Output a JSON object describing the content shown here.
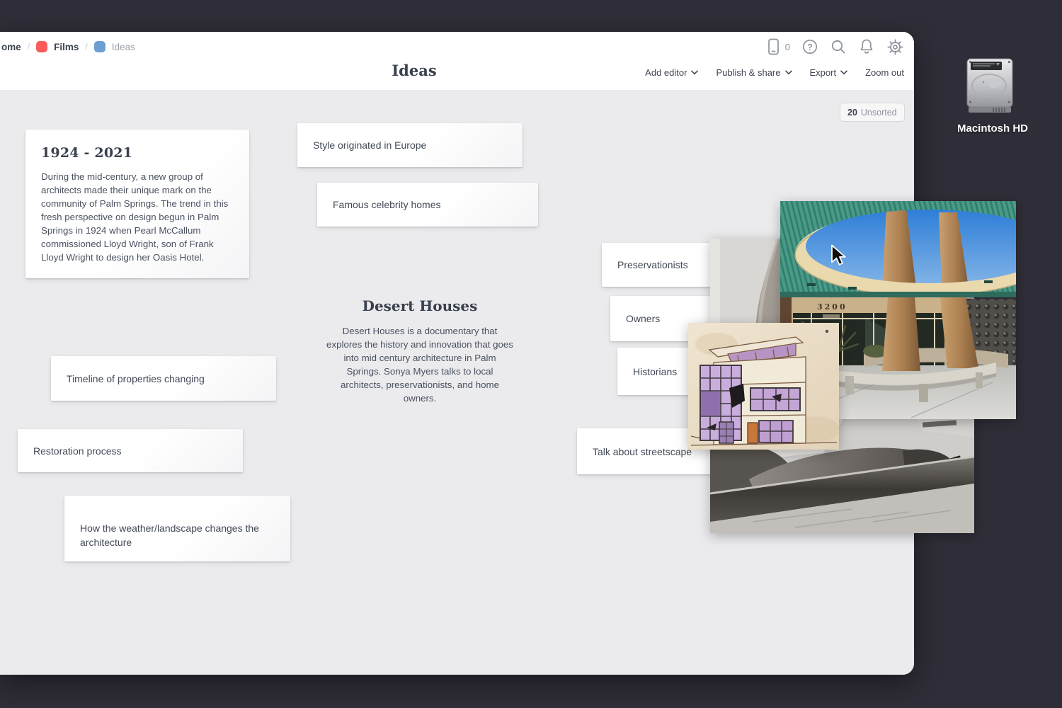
{
  "desktop": {
    "bg_color": "#2f2d37",
    "macintosh_hd_label": "Macintosh HD"
  },
  "window": {
    "breadcrumb": {
      "home_label": "ome",
      "separator": "/",
      "films_label": "Films",
      "ideas_label": "Ideas",
      "films_chip_color": "#fc5b5b",
      "ideas_chip_color": "#6d9fd2"
    },
    "icons": {
      "device_count": "0",
      "help_glyph": "?"
    },
    "title": "Ideas",
    "toolbar": {
      "add_editor": "Add editor",
      "publish_share": "Publish & share",
      "export": "Export",
      "zoom_out": "Zoom out"
    },
    "unsorted_badge": {
      "count": "20",
      "label": "Unsorted"
    }
  },
  "board": {
    "note_1924": {
      "title": "1924 - 2021",
      "body": "During the mid-century, a new group of architects made their unique mark on the community of Palm Springs. The trend in this fresh perspective on design begun in Palm Springs in 1924 when Pearl McCallum commissioned Lloyd Wright, son of Frank Lloyd Wright to design her Oasis Hotel."
    },
    "desert": {
      "title": "Desert Houses",
      "body": "Desert Houses is a documentary that explores the history and innovation that goes into mid century architecture in Palm Springs. Sonya Myers talks to local architects, preservationists, and home owners."
    },
    "cards": [
      {
        "text": "Style originated in Europe"
      },
      {
        "text": "Famous celebrity homes"
      },
      {
        "text": "Timeline of properties changing"
      },
      {
        "text": "Restoration process"
      },
      {
        "text": "How the weather/landscape changes the architecture"
      },
      {
        "text": "Preservationists"
      },
      {
        "text": "Owners"
      },
      {
        "text": "Historians"
      },
      {
        "text": "Talk about streetscape"
      }
    ],
    "photo_sign": "3200",
    "accent_teal": "#4a9a87"
  }
}
